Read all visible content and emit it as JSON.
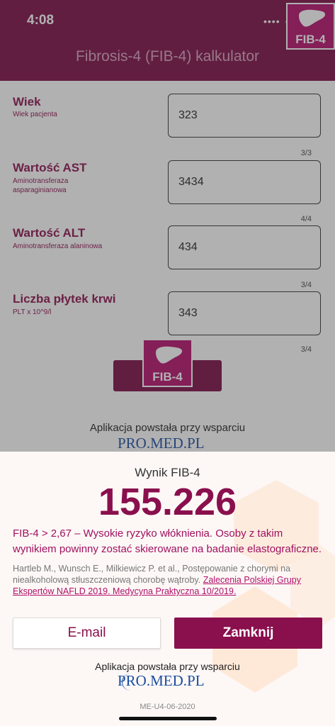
{
  "status_bar": {
    "time": "4:08"
  },
  "header": {
    "title": "Fibrosis-4 (FIB-4) kalkulator",
    "logo_text": "FIB-4"
  },
  "form": {
    "fields": [
      {
        "label": "Wiek",
        "sub": "Wiek pacjenta",
        "value": "323",
        "counter": "3/3"
      },
      {
        "label": "Wartość AST",
        "sub": "Aminotransferaza asparaginianowa",
        "value": "3434",
        "counter": "4/4"
      },
      {
        "label": "Wartość ALT",
        "sub": "Aminotransferaza alaninowa",
        "value": "434",
        "counter": "3/4"
      },
      {
        "label": "Liczba płytek krwi",
        "sub": "PLT x 10^9/l",
        "value": "343",
        "counter": "3/4"
      }
    ],
    "calc_logo_text": "FIB-4",
    "support_text": "Aplikacja powstała przy wsparciu",
    "sponsor": "PRO.MED.PL"
  },
  "result": {
    "title": "Wynik FIB-4",
    "value": "155.226",
    "description": "FIB-4 > 2,67 – Wysokie ryzyko włóknienia. Osoby z takim wynikiem powinny zostać skierowane na badanie elastograficzne.",
    "citation_text": "Hartleb M., Wunsch E., Milkiewicz P. et al., Postępowanie z chorymi na niealkoholową stłuszczeniową chorobę wątroby.",
    "citation_link": "Zalecenia Polskiej Grupy Ekspertów NAFLD 2019. Medycyna Praktyczna 10/2019."
  },
  "actions": {
    "email_label": "E-mail",
    "close_label": "Zamknij"
  },
  "footer": {
    "support_text": "Aplikacja powstała przy wsparciu",
    "sponsor": "PRO.MED.PL",
    "version": "ME-U4-06-2020"
  },
  "colors": {
    "brand": "#7b0a45",
    "accent": "#b50d6b",
    "text_accent": "#8a0f4d"
  },
  "icons": {
    "liver": "liver-icon",
    "more": "more-dots-icon"
  }
}
